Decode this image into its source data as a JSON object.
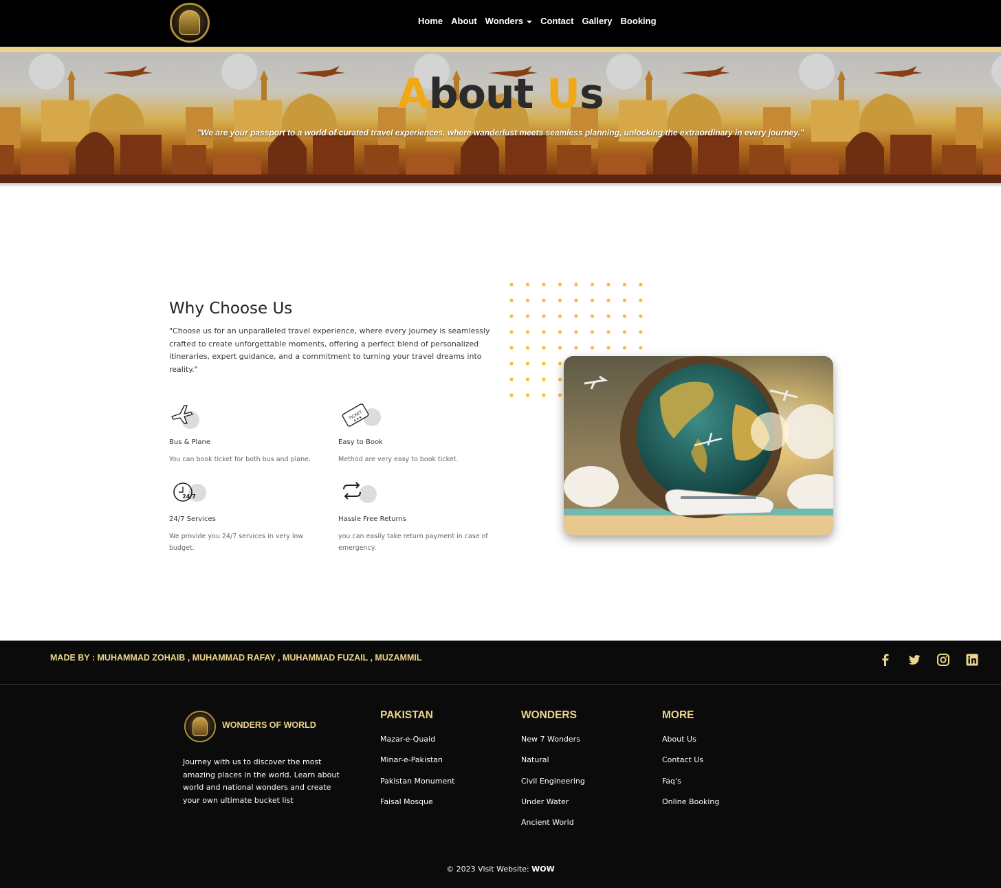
{
  "nav": {
    "items": [
      {
        "label": "Home"
      },
      {
        "label": "About"
      },
      {
        "label": "Wonders"
      },
      {
        "label": "Contact"
      },
      {
        "label": "Gallery"
      },
      {
        "label": "Booking"
      }
    ]
  },
  "hero": {
    "title_first_letter": "A",
    "title_part1": "bout ",
    "title_second_letter": "U",
    "title_part2": "s",
    "quote": "\"We are your passport to a world of curated travel experiences, where wanderlust meets seamless planning, unlocking the extraordinary in every journey.\""
  },
  "why": {
    "title": "Why Choose Us",
    "text": "\"Choose us for an unparalleled travel experience, where every journey is seamlessly crafted to create unforgettable moments, offering a perfect blend of personalized itineraries, expert guidance, and a commitment to turning your travel dreams into reality.\"",
    "features": [
      {
        "title": "Bus & Plane",
        "desc": "You can book ticket for both bus and plane.",
        "icon": "airplane-icon"
      },
      {
        "title": "Easy to Book",
        "desc": "Method are very easy to book ticket.",
        "icon": "ticket-icon"
      },
      {
        "title": "24/7 Services",
        "desc": "We provide you 24/7 services in very low budget.",
        "icon": "clock-24-7-icon",
        "icon_text": "24/7"
      },
      {
        "title": "Hassle Free Returns",
        "desc": "you can easily take return payment in case of emergency.",
        "icon": "return-arrows-icon"
      }
    ],
    "ticket_icon_text": "TICKET"
  },
  "footer": {
    "made_by": "MADE BY : MUHAMMAD ZOHAIB , MUHAMMAD RAFAY , MUHAMMAD FUZAIL , MUZAMMIL",
    "social": [
      "facebook-icon",
      "twitter-icon",
      "instagram-icon",
      "linkedin-icon"
    ],
    "brand": "WONDERS OF WORLD",
    "description": "Journey with us to discover the most amazing places in the world. Learn about world and national wonders and create your own ultimate bucket list",
    "columns": [
      {
        "title": "PAKISTAN",
        "links": [
          "Mazar-e-Quaid",
          "Minar-e-Pakistan",
          "Pakistan Monument",
          "Faisal Mosque"
        ]
      },
      {
        "title": "WONDERS",
        "links": [
          "New 7 Wonders",
          "Natural",
          "Civil Engineering",
          "Under Water",
          "Ancient World"
        ]
      },
      {
        "title": "MORE",
        "links": [
          "About Us",
          "Contact Us",
          "Faq's",
          "Online Booking"
        ]
      }
    ],
    "copyright_prefix": "© 2023 Visit Website: ",
    "copyright_brand": "WOW"
  },
  "colors": {
    "gold": "#ecd48a",
    "accent_orange": "#f1a817",
    "footer_bg": "#0b0b0b",
    "nav_bg": "#000000"
  }
}
